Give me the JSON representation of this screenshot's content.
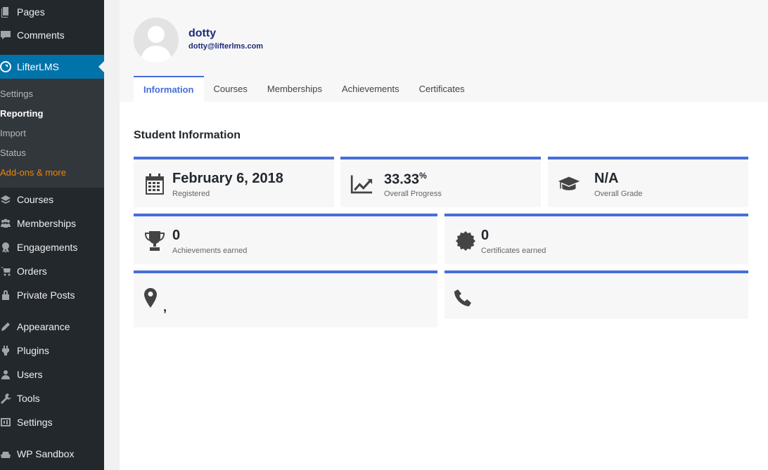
{
  "sidebar": {
    "items": [
      {
        "label": "Pages",
        "icon": "pages-icon"
      },
      {
        "label": "Comments",
        "icon": "comments-icon"
      },
      {
        "label": "LifterLMS",
        "icon": "lifterlms-icon"
      },
      {
        "label": "Courses",
        "icon": "courses-icon"
      },
      {
        "label": "Memberships",
        "icon": "memberships-icon"
      },
      {
        "label": "Engagements",
        "icon": "engagements-icon"
      },
      {
        "label": "Orders",
        "icon": "orders-icon"
      },
      {
        "label": "Private Posts",
        "icon": "lock-icon"
      },
      {
        "label": "Appearance",
        "icon": "appearance-icon"
      },
      {
        "label": "Plugins",
        "icon": "plugins-icon"
      },
      {
        "label": "Users",
        "icon": "users-icon"
      },
      {
        "label": "Tools",
        "icon": "tools-icon"
      },
      {
        "label": "Settings",
        "icon": "settings-icon"
      },
      {
        "label": "WP Sandbox",
        "icon": "sandbox-icon"
      }
    ],
    "submenu": [
      "Settings",
      "Reporting",
      "Import",
      "Status",
      "Add-ons & more"
    ]
  },
  "student": {
    "name": "dotty",
    "email": "dotty@lifterlms.com"
  },
  "tabs": [
    "Information",
    "Courses",
    "Memberships",
    "Achievements",
    "Certificates"
  ],
  "section_title": "Student Information",
  "cards": {
    "registered": {
      "value": "February 6, 2018",
      "label": "Registered"
    },
    "progress": {
      "value": "33.33",
      "unit": "%",
      "label": "Overall Progress"
    },
    "grade": {
      "value": "N/A",
      "label": "Overall Grade"
    },
    "achievements": {
      "value": "0",
      "label": "Achievements earned"
    },
    "certificates": {
      "value": "0",
      "label": "Certificates earned"
    },
    "address": {
      "value": ","
    },
    "phone": {
      "value": ""
    }
  },
  "colors": {
    "accent": "#466dd8",
    "sidebar": "#23282d",
    "active_menu": "#0073aa",
    "addons": "#f18500"
  }
}
